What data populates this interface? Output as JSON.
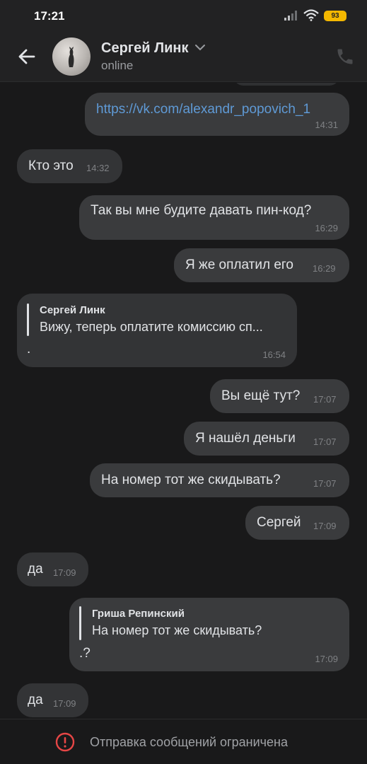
{
  "status_bar": {
    "time": "17:21",
    "battery": "93",
    "icons": [
      "signal-icon",
      "wifi-icon",
      "battery-icon"
    ]
  },
  "header": {
    "back_icon": "arrow-left-icon",
    "name": "Сергей Линк",
    "status": "online",
    "call_icon": "phone-icon"
  },
  "messages": [
    {
      "dir": "out",
      "text": "https://vk.com/alexandr_popovich_1",
      "time": "14:31",
      "is_link": true
    },
    {
      "dir": "in",
      "text": "Кто это",
      "time": "14:32"
    },
    {
      "dir": "out",
      "text": "Так вы мне будите давать пин-код?",
      "time": "16:29"
    },
    {
      "dir": "out",
      "text": "Я же оплатил его",
      "time": "16:29"
    },
    {
      "dir": "in",
      "reply_author": "Сергей Линк",
      "reply_text": "Вижу, теперь оплатите комиссию сп...",
      "text": ".",
      "time": "16:54"
    },
    {
      "dir": "out",
      "text": "Вы ещё тут?",
      "time": "17:07"
    },
    {
      "dir": "out",
      "text": "Я нашёл деньги",
      "time": "17:07"
    },
    {
      "dir": "out",
      "text": "На номер тот же скидывать?",
      "time": "17:07"
    },
    {
      "dir": "out",
      "text": "Сергей",
      "time": "17:09"
    },
    {
      "dir": "in",
      "text": "да",
      "time": "17:09"
    },
    {
      "dir": "out",
      "reply_author": "Гриша Репинский",
      "reply_text": "На номер тот же скидывать?",
      "text": ".?",
      "time": "17:09"
    },
    {
      "dir": "in",
      "text": "да",
      "time": "17:09"
    }
  ],
  "footer": {
    "icon": "alert-circle-icon",
    "text": "Отправка сообщений ограничена",
    "accent": "#e64646"
  }
}
